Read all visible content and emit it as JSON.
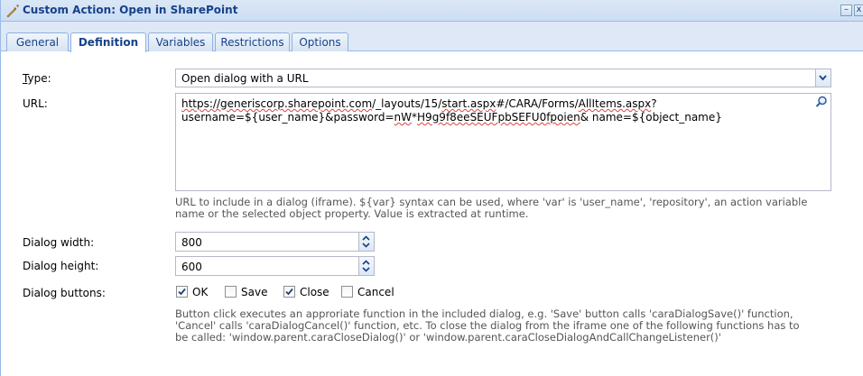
{
  "window": {
    "title": "Custom Action: Open in SharePoint",
    "minimize_glyph": "–",
    "close_glyph": "x"
  },
  "tabs": [
    {
      "label": "General",
      "active": false
    },
    {
      "label": "Definition",
      "active": true
    },
    {
      "label": "Variables",
      "active": false
    },
    {
      "label": "Restrictions",
      "active": false
    },
    {
      "label": "Options",
      "active": false
    }
  ],
  "form": {
    "type_label_accel": "T",
    "type_label_rest": "ype:",
    "type_value": "Open dialog with a URL",
    "url_label": "URL:",
    "url_line1_a": "https://",
    "url_line1_b": "generiscorp.sharepoint.com",
    "url_line1_c": "/_layouts/15/",
    "url_line1_d": "start.aspx",
    "url_line1_e": "#/CARA/Forms/",
    "url_line1_f": "AllItems.aspx",
    "url_line1_g": "?",
    "url_line2_a": "username=${user_name}&password=",
    "url_line2_b": "nW",
    "url_line2_c": "*",
    "url_line2_d": "H9g9f8eeSEUFpbSEFU0fpoien",
    "url_line2_e": "& name=${object_name}",
    "url_help_line1": "URL to include in a dialog (iframe). ${var} syntax can be used, where 'var' is 'user_name', 'repository', an action variable",
    "url_help_line2": "name or the selected object property. Value is extracted at runtime.",
    "dialog_width_label": "Dialog width:",
    "dialog_width_value": "800",
    "dialog_height_label": "Dialog height:",
    "dialog_height_value": "600",
    "dialog_buttons_label": "Dialog buttons:",
    "buttons": [
      {
        "label": "OK",
        "checked": true
      },
      {
        "label": "Save",
        "checked": false
      },
      {
        "label": "Close",
        "checked": true
      },
      {
        "label": "Cancel",
        "checked": false
      }
    ],
    "buttons_help_line1": "Button click executes an approriate function in the included dialog, e.g. 'Save' button calls 'caraDialogSave()' function,",
    "buttons_help_line2": "'Cancel' calls 'caraDialogCancel()' function, etc. To close the dialog from the iframe one of the following functions has to",
    "buttons_help_line3": "be called: 'window.parent.caraCloseDialog()' or 'window.parent.caraCloseDialogAndCallChangeListener()'"
  },
  "icons": {
    "title": "wrench-icon",
    "combo_trigger": "chevron-down-icon",
    "url_lookup": "search-icon",
    "spinner": "spinner-arrows-icon",
    "checkbox": "checkmark-icon"
  },
  "colors": {
    "title_text": "#15428b",
    "tab_bar": "#dfe8f6",
    "border": "#99bbe8",
    "help_text": "#555555"
  }
}
